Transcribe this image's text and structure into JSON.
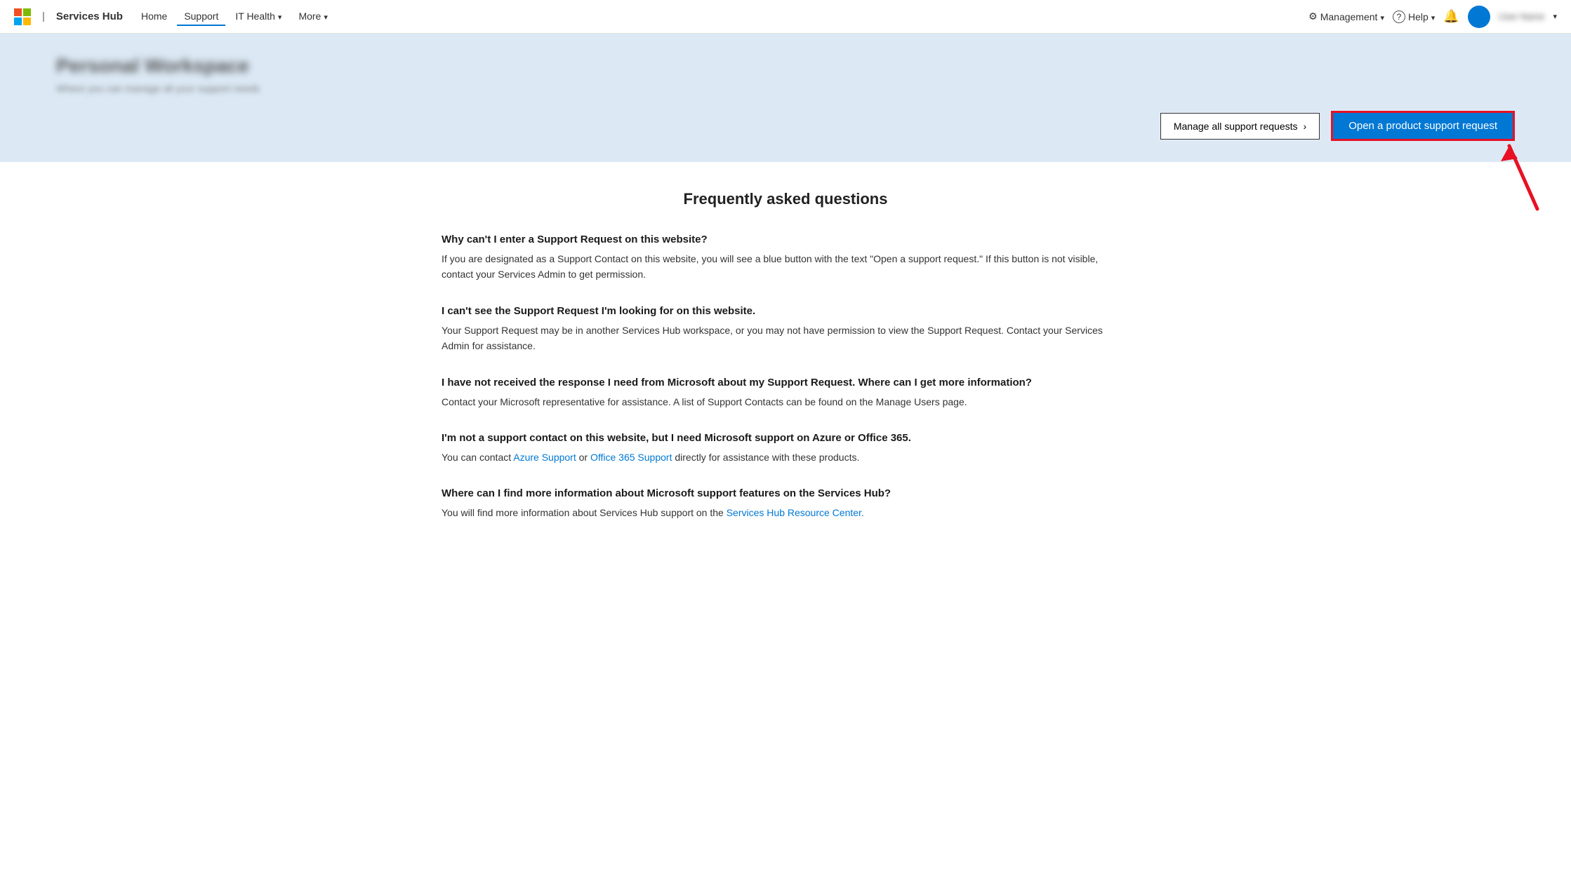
{
  "navbar": {
    "brand": "Services Hub",
    "nav_items": [
      {
        "label": "Home",
        "active": false
      },
      {
        "label": "Support",
        "active": true
      },
      {
        "label": "IT Health",
        "has_dropdown": true
      },
      {
        "label": "More",
        "has_dropdown": true
      }
    ],
    "right_items": [
      {
        "label": "Management",
        "has_dropdown": true,
        "icon": "gear-icon"
      },
      {
        "label": "Help",
        "has_dropdown": true,
        "icon": "help-icon"
      },
      {
        "label": "",
        "icon": "notification-icon"
      }
    ]
  },
  "hero": {
    "title": "Personal Workspace",
    "subtitle": "Where you can manage all your support needs",
    "btn_manage_label": "Manage all support requests",
    "btn_open_label": "Open a product support request"
  },
  "faq": {
    "title": "Frequently asked questions",
    "items": [
      {
        "question": "Why can't I enter a Support Request on this website?",
        "answer": "If you are designated as a Support Contact on this website, you will see a blue button with the text \"Open a support request.\" If this button is not visible, contact your Services Admin to get permission."
      },
      {
        "question": "I can't see the Support Request I'm looking for on this website.",
        "answer": "Your Support Request may be in another Services Hub workspace, or you may not have permission to view the Support Request. Contact your Services Admin for assistance."
      },
      {
        "question": "I have not received the response I need from Microsoft about my Support Request. Where can I get more information?",
        "answer": "Contact your Microsoft representative for assistance. A list of Support Contacts can be found on the Manage Users page."
      },
      {
        "question": "I'm not a support contact on this website, but I need Microsoft support on Azure or Office 365.",
        "answer_parts": [
          {
            "text": "You can contact ",
            "type": "text"
          },
          {
            "text": "Azure Support",
            "type": "link",
            "href": "#"
          },
          {
            "text": " or ",
            "type": "text"
          },
          {
            "text": "Office 365 Support",
            "type": "link",
            "href": "#"
          },
          {
            "text": " directly for assistance with these products.",
            "type": "text"
          }
        ]
      },
      {
        "question": "Where can I find more information about Microsoft support features on the Services Hub?",
        "answer_parts": [
          {
            "text": "You will find more information about Services Hub support on the ",
            "type": "text"
          },
          {
            "text": "Services Hub Resource Center.",
            "type": "link",
            "href": "#"
          }
        ]
      }
    ]
  }
}
